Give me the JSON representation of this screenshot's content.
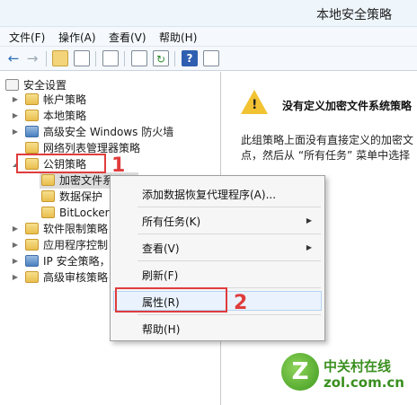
{
  "window": {
    "title": "本地安全策略"
  },
  "menu": [
    "文件(F)",
    "操作(A)",
    "查看(V)",
    "帮助(H)"
  ],
  "tree": {
    "root": "安全设置",
    "items": [
      {
        "label": "帐户策略"
      },
      {
        "label": "本地策略"
      },
      {
        "label": "高级安全 Windows 防火墙"
      },
      {
        "label": "网络列表管理器策略"
      },
      {
        "label": "公钥策略"
      },
      {
        "label": "加密文件系统"
      },
      {
        "label": "数据保护"
      },
      {
        "label": "BitLocker"
      },
      {
        "label": "软件限制策略"
      },
      {
        "label": "应用程序控制"
      },
      {
        "label": "IP 安全策略，"
      },
      {
        "label": "高级审核策略"
      }
    ]
  },
  "right_pane": {
    "title": "没有定义加密文件系统策略",
    "body_line1": "此组策略上面没有直接定义的加密文",
    "body_line2": "点，然后从 “所有任务” 菜单中选择"
  },
  "context_menu": {
    "items": [
      {
        "label": "添加数据恢复代理程序(A)..."
      },
      {
        "label": "所有任务(K)"
      },
      {
        "label": "查看(V)"
      },
      {
        "label": "刷新(F)"
      },
      {
        "label": "属性(R)"
      },
      {
        "label": "帮助(H)"
      }
    ]
  },
  "annotations": {
    "step1": "1",
    "step2": "2"
  },
  "watermark": {
    "brand": "中关村在线",
    "domain": "zol.com.cn",
    "logo_letter": "Z"
  },
  "colors": {
    "annotation": "#e03c3c",
    "title_bar": "#eef6fc",
    "hover": "#eaf3fd",
    "watermark": "#3a8f1f"
  }
}
